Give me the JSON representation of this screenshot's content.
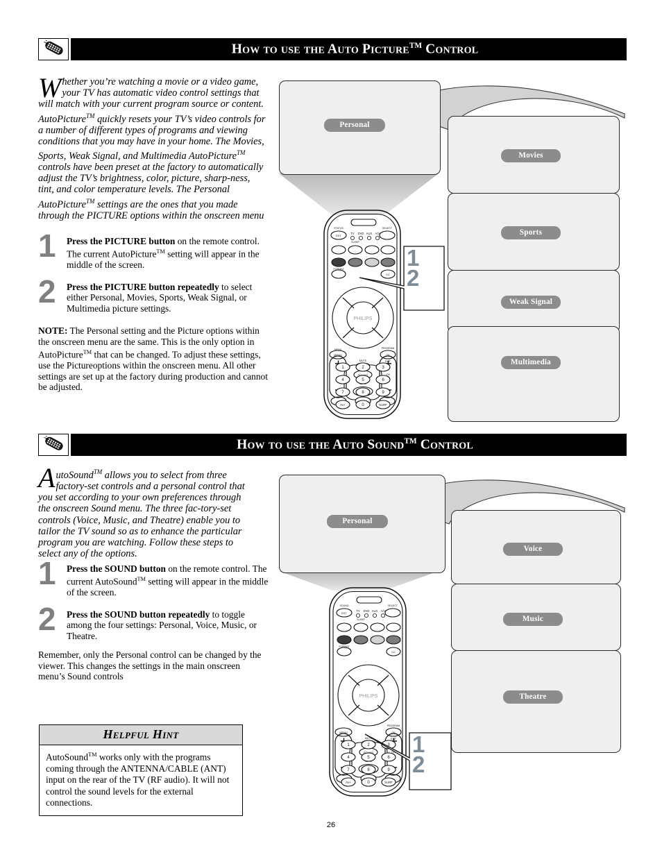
{
  "page": {
    "number": "26",
    "accent_gray": "#8c8c8c",
    "panel_fill": "#efefef",
    "header_bg": "#000000",
    "step_number_color": "#808080",
    "callout_number_color": "#7f8c96"
  },
  "sections": [
    {
      "id": "auto-picture",
      "header": {
        "title_prefix": "How to use the Auto Picture",
        "title_tm": "TM",
        "title_suffix": " Control",
        "icon": "remote-control-icon"
      },
      "intro": {
        "dropcap": "W",
        "text": "hether you’re watching a movie or a video game, your TV has automatic video control settings that will match with your current program source or content.  AutoPicture",
        "text2": " quickly resets your TV’s video controls for a number of different types of programs and viewing conditions that you may have in your home.  The Movies, Sports, Weak Signal, and Multimedia AutoPicture",
        "text3": " controls have been preset at the factory to automatically adjust the TV’s brightness, color, picture, sharp-ness, tint, and color temperature levels.  The Personal AutoPicture",
        "text4": " settings are the ones that you made through the PICTURE options within the onscreen menu"
      },
      "steps": [
        {
          "number": "1",
          "bold": "Press the PICTURE button",
          "rest": " on the remote control.  The current AutoPicture",
          "rest2": " setting will appear in the middle of the screen."
        },
        {
          "number": "2",
          "bold": "Press the PICTURE button repeatedly",
          "rest": " to select either Personal, Movies, Sports, Weak Signal, or Multimedia picture settings.",
          "rest2": ""
        }
      ],
      "note": {
        "label": "NOTE:",
        "text": "  The Personal setting and the Picture options within the onscreen menu are the same. This is the only option in AutoPicture",
        "text2": " that can be changed. To adjust these settings, use the Pictureoptions within the onscreen menu. All other settings are set up at the factory during production and cannot be adjusted."
      },
      "diagram": {
        "source_panel_label": "Personal",
        "target_panels": [
          {
            "label": "Movies"
          },
          {
            "label": "Sports"
          },
          {
            "label": "Weak Signal"
          },
          {
            "label": "Multimedia"
          }
        ],
        "callout_numbers": [
          "1",
          "2"
        ],
        "remote": {
          "brand": "PHILIPS",
          "top_labels": [
            "STATUS",
            "TV",
            "DVD",
            "AUX",
            "A/V",
            "SELECT"
          ],
          "row_labels": [
            "SLEEP",
            "FORMAT"
          ],
          "buttons": [
            "EXT",
            "MENU",
            "OK",
            "MUTE",
            "SOUND",
            "AUTO",
            "PICTURE",
            "CH",
            "VOL",
            "EXIT",
            "PROGRAM",
            "CC"
          ],
          "keypad": [
            "1",
            "2",
            "3",
            "4",
            "5",
            "6",
            "7",
            "8",
            "9",
            "AV+",
            "0",
            "SURF"
          ],
          "highlight_button": "PICTURE"
        }
      }
    },
    {
      "id": "auto-sound",
      "header": {
        "title_prefix": "How to use the Auto Sound",
        "title_tm": "TM",
        "title_suffix": " Control",
        "icon": "remote-control-icon"
      },
      "intro": {
        "dropcap": "A",
        "text": "utoSound",
        "text2": " allows you to select from three factory-set controls and a personal control that you set according to your own preferences through the onscreen Sound menu. The three fac-tory-set controls (Voice, Music, and Theatre) enable you to tailor the TV sound so as to enhance the particular program you are watching. Follow these steps to select any of the options."
      },
      "steps": [
        {
          "number": "1",
          "bold": "Press the SOUND button",
          "rest": " on the remote control.  The current AutoSound",
          "rest2": " setting will appear in the middle of the screen."
        },
        {
          "number": "2",
          "bold": "Press the SOUND button repeatedly",
          "rest": " to toggle among the four settings:  Personal, Voice, Music, or Theatre.",
          "rest2": ""
        }
      ],
      "remember": "Remember, only the Personal control can be changed by the viewer.  This changes the settings in the main onscreen menu’s Sound controls",
      "diagram": {
        "source_panel_label": "Personal",
        "target_panels": [
          {
            "label": "Voice"
          },
          {
            "label": "Music"
          },
          {
            "label": "Theatre"
          }
        ],
        "callout_numbers": [
          "1",
          "2"
        ],
        "remote": {
          "brand": "PHILIPS",
          "top_labels": [
            "SOUND",
            "TV",
            "DVD",
            "AUX",
            "A/V",
            "SELECT"
          ],
          "row_labels": [
            "SLEEP",
            "FORMAT"
          ],
          "buttons": [
            "EXT",
            "MENU",
            "OK",
            "MUTE",
            "SOUND",
            "AUTO",
            "PICTURE",
            "CH",
            "VOL",
            "EXIT",
            "PROGRAM",
            "CC"
          ],
          "keypad": [
            "1",
            "2",
            "3",
            "4",
            "5",
            "6",
            "7",
            "8",
            "9",
            "AV+",
            "0",
            "SURF"
          ],
          "highlight_button": "SOUND"
        }
      }
    }
  ],
  "hint": {
    "title": "Helpful Hint",
    "text": "AutoSound",
    "text2": " works only with the programs coming through the ANTENNA/CABLE (ANT) input on the rear of the TV (RF audio).  It will not control the sound levels for the external connections."
  }
}
